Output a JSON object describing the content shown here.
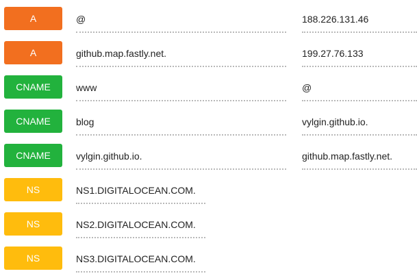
{
  "records": [
    {
      "type": "A",
      "host": "@",
      "value": "188.226.131.46"
    },
    {
      "type": "A",
      "host": "github.map.fastly.net.",
      "value": "199.27.76.133"
    },
    {
      "type": "CNAME",
      "host": "www",
      "value": "@"
    },
    {
      "type": "CNAME",
      "host": "blog",
      "value": "vylgin.github.io."
    },
    {
      "type": "CNAME",
      "host": "vylgin.github.io.",
      "value": "github.map.fastly.net."
    },
    {
      "type": "NS",
      "host": "NS1.DIGITALOCEAN.COM."
    },
    {
      "type": "NS",
      "host": "NS2.DIGITALOCEAN.COM."
    },
    {
      "type": "NS",
      "host": "NS3.DIGITALOCEAN.COM."
    }
  ],
  "colors": {
    "A": "#f26f1f",
    "CNAME": "#22b23d",
    "NS": "#ffbc0d"
  }
}
